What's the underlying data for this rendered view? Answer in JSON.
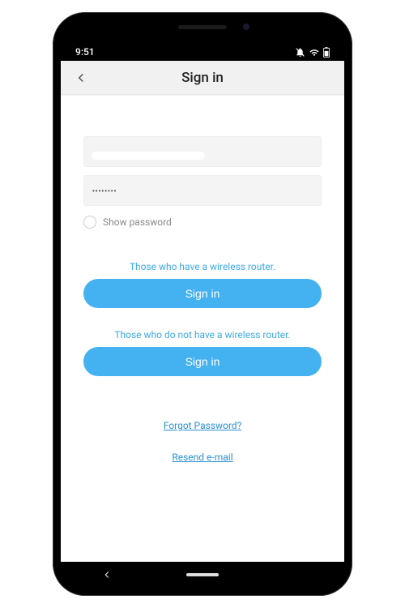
{
  "status": {
    "time": "9:51"
  },
  "header": {
    "title": "Sign in"
  },
  "form": {
    "email_value": "",
    "password_value": "••••••••",
    "show_password_label": "Show password"
  },
  "section1": {
    "hint": "Those who have a wireless router.",
    "button": "Sign in"
  },
  "section2": {
    "hint": "Those who do not have a wireless router.",
    "button": "Sign in"
  },
  "links": {
    "forgot": "Forgot Password?",
    "resend": "Resend e-mail"
  },
  "colors": {
    "accent": "#44b1f0",
    "link": "#2a8fd4"
  }
}
